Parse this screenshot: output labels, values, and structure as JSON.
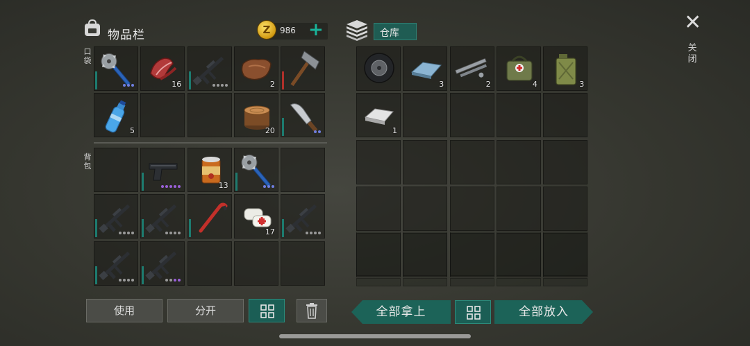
{
  "header": {
    "title": "物品栏",
    "coins": "986",
    "storage_title": "仓库",
    "coin_symbol": "Z"
  },
  "labels": {
    "pocket": "口袋",
    "backpack": "背包",
    "close": "关闭"
  },
  "pocket_items": [
    {
      "name": "saw-blade-club-icon",
      "count": "",
      "dots": [
        "#6f7fe0",
        "#6f7fe0",
        "#6f7fe0"
      ],
      "bar": "#1d7b6f"
    },
    {
      "name": "raw-meat-icon",
      "count": "16"
    },
    {
      "name": "assault-rifle-icon",
      "count": "",
      "dots": [
        "#9a9a9a",
        "#9a9a9a",
        "#9a9a9a",
        "#9a9a9a"
      ],
      "bar": "#1d7b6f"
    },
    {
      "name": "leather-icon",
      "count": "2"
    },
    {
      "name": "hatchet-icon",
      "count": "",
      "bar": "#b0302a"
    },
    {
      "name": "water-bottle-icon",
      "count": "5"
    },
    {
      "name": "empty",
      "count": ""
    },
    {
      "name": "empty",
      "count": ""
    },
    {
      "name": "log-stump-icon",
      "count": "20"
    },
    {
      "name": "machete-icon",
      "count": "",
      "dots": [
        "#6f7fe0",
        "#6f7fe0"
      ],
      "bar": "#1d7b6f"
    }
  ],
  "backpack_items": [
    {
      "name": "empty",
      "count": ""
    },
    {
      "name": "pistol-icon",
      "count": "",
      "dots": [
        "#9a60d8",
        "#9a60d8",
        "#9a60d8",
        "#9a60d8",
        "#9a60d8"
      ],
      "bar": "#1d7b6f"
    },
    {
      "name": "canned-food-icon",
      "count": "13"
    },
    {
      "name": "saw-blade-club-icon",
      "count": "",
      "dots": [
        "#6f7fe0",
        "#6f7fe0",
        "#6f7fe0"
      ],
      "bar": "#1d7b6f"
    },
    {
      "name": "empty",
      "count": ""
    },
    {
      "name": "assault-rifle-icon",
      "count": "",
      "dots": [
        "#9a9a9a",
        "#9a9a9a",
        "#9a9a9a",
        "#9a9a9a"
      ],
      "bar": "#1d7b6f"
    },
    {
      "name": "assault-rifle-icon",
      "count": "",
      "dots": [
        "#9a9a9a",
        "#9a9a9a",
        "#9a9a9a",
        "#9a9a9a"
      ],
      "bar": "#1d7b6f"
    },
    {
      "name": "crowbar-icon",
      "count": "",
      "bar": "#1d7b6f"
    },
    {
      "name": "bandage-icon",
      "count": "17"
    },
    {
      "name": "assault-rifle-icon",
      "count": "",
      "dots": [
        "#9a9a9a",
        "#9a9a9a",
        "#9a9a9a",
        "#9a9a9a"
      ],
      "bar": "#1d7b6f"
    },
    {
      "name": "assault-rifle-icon",
      "count": "",
      "dots": [
        "#9a9a9a",
        "#9a9a9a",
        "#9a9a9a",
        "#9a9a9a"
      ],
      "bar": "#1d7b6f"
    },
    {
      "name": "assault-rifle-icon",
      "count": "",
      "dots": [
        "#9a9a9a",
        "#9a9a9a",
        "#9a60d8",
        "#9a60d8"
      ],
      "bar": "#1d7b6f"
    },
    {
      "name": "empty",
      "count": ""
    },
    {
      "name": "empty",
      "count": ""
    },
    {
      "name": "empty",
      "count": ""
    }
  ],
  "storage_items": [
    {
      "name": "tire-icon",
      "count": ""
    },
    {
      "name": "steel-ingot-icon",
      "count": "3"
    },
    {
      "name": "pipes-icon",
      "count": "2"
    },
    {
      "name": "medkit-bag-icon",
      "count": "4"
    },
    {
      "name": "jerrycan-icon",
      "count": "3"
    },
    {
      "name": "silver-ingot-icon",
      "count": "1"
    }
  ],
  "buttons": {
    "use": "使用",
    "split": "分开",
    "take_all": "全部拿上",
    "put_all": "全部放入"
  },
  "colors": {
    "accent": "#1d7b6f",
    "teal_button": "#1c6358",
    "coin": "#d19a12"
  }
}
